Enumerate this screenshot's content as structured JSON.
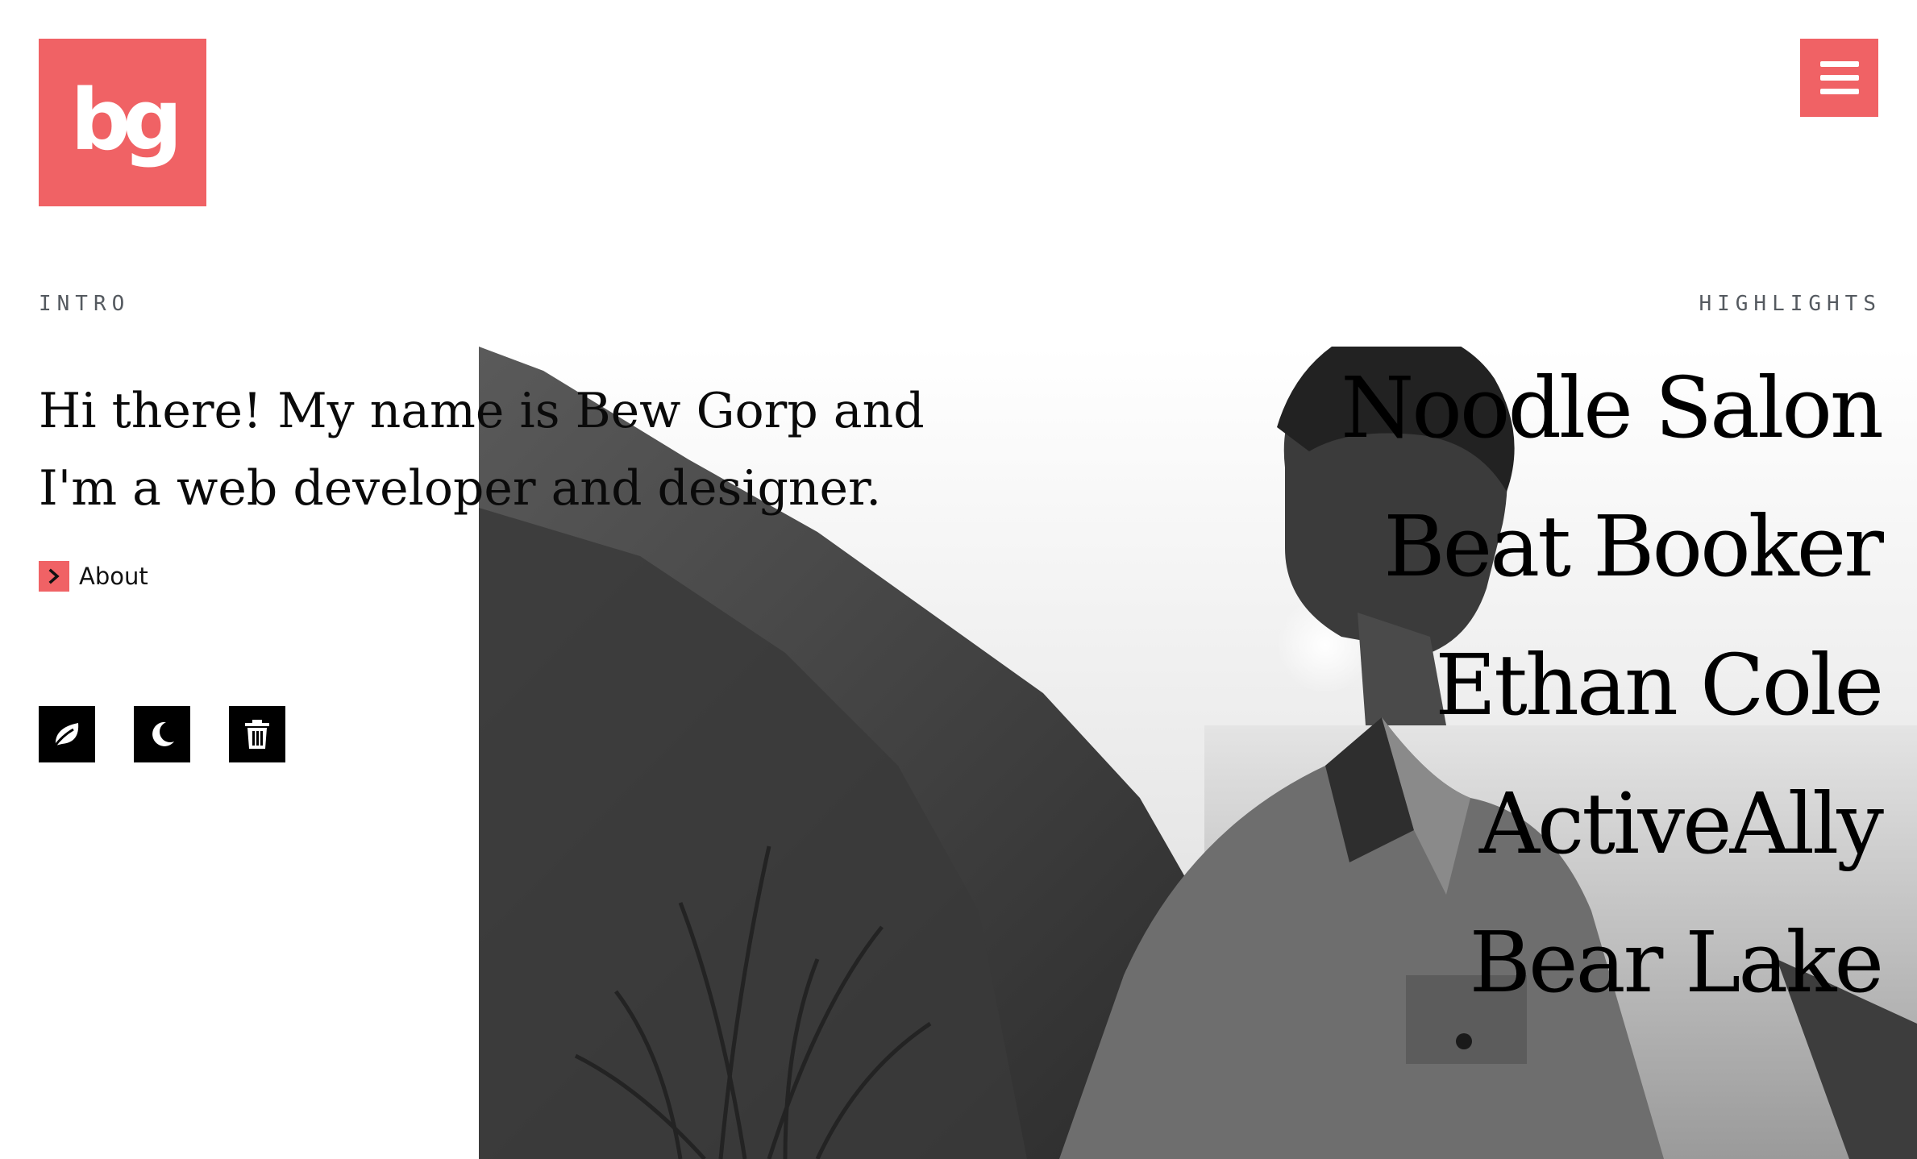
{
  "logo": {
    "text": "bg",
    "color": "#f06265"
  },
  "menu": {
    "icon": "hamburger-icon"
  },
  "intro": {
    "label": "INTRO",
    "text": "Hi there! My name is Bew Gorp and I'm a web developer and designer.",
    "link_label": "About",
    "link_icon": "chevron-right-icon"
  },
  "theme_buttons": [
    {
      "icon": "leaf-icon"
    },
    {
      "icon": "moon-icon"
    },
    {
      "icon": "trash-icon"
    }
  ],
  "highlights": {
    "label": "HIGHLIGHTS",
    "items": [
      "Noodle Salon",
      "Beat Booker",
      "Ethan Cole",
      "ActiveAlly",
      "Bear Lake"
    ]
  },
  "colors": {
    "accent": "#f06265",
    "text": "#0a0a0a",
    "label": "#555a60"
  }
}
